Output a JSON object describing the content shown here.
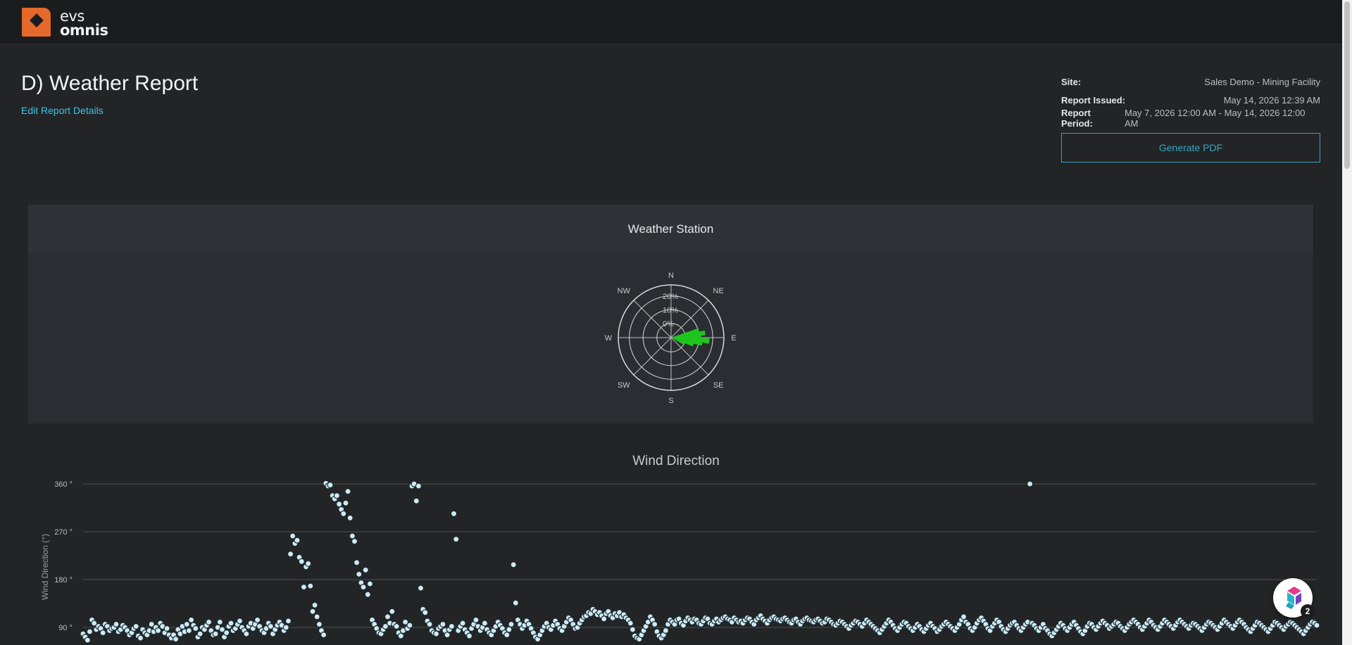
{
  "brand": {
    "line1": "evs",
    "line2": "omnis"
  },
  "page": {
    "title": "D) Weather Report",
    "edit_link": "Edit Report Details"
  },
  "meta": [
    {
      "label": "Site:",
      "value": "Sales Demo - Mining Facility"
    },
    {
      "label": "Report Issued:",
      "value": "May 14, 2026 12:39 AM"
    },
    {
      "label": "Report Period:",
      "value": "May 7, 2026 12:00 AM - May 14, 2026 12:00 AM"
    }
  ],
  "generate_pdf_label": "Generate PDF",
  "station": {
    "title": "Weather Station",
    "compass": [
      "N",
      "NE",
      "E",
      "SE",
      "S",
      "SW",
      "W",
      "NW"
    ],
    "rings": [
      "0%",
      "10%",
      "20%"
    ],
    "petal_color": "#1ec51e"
  },
  "wind": {
    "title": "Wind Direction",
    "ylabel": "Wind Direction (°)",
    "ticks": [
      "360 °",
      "270 °",
      "180 °",
      "90 °"
    ]
  },
  "help_badge": "2",
  "chart_data": [
    {
      "type": "scatter",
      "subtype": "wind-rose",
      "title": "Weather Station",
      "directions": [
        "N",
        "NE",
        "E",
        "SE",
        "S",
        "SW",
        "W",
        "NW"
      ],
      "radial_ticks": [
        "0%",
        "10%",
        "20%"
      ],
      "petals": [
        {
          "direction_deg": 75,
          "percent": 18
        },
        {
          "direction_deg": 82,
          "percent": 22
        },
        {
          "direction_deg": 88,
          "percent": 19
        },
        {
          "direction_deg": 95,
          "percent": 25
        },
        {
          "direction_deg": 101,
          "percent": 20
        },
        {
          "direction_deg": 108,
          "percent": 14
        },
        {
          "direction_deg": 115,
          "percent": 8
        }
      ]
    },
    {
      "type": "scatter",
      "title": "Wind Direction",
      "ylabel": "Wind Direction (°)",
      "ylim": [
        60,
        360
      ],
      "yticks": [
        90,
        180,
        270,
        360
      ],
      "point_color": "#cfeaf2",
      "y": [
        78,
        72,
        66,
        82,
        104,
        98,
        86,
        92,
        88,
        80,
        96,
        92,
        84,
        88,
        90,
        96,
        82,
        86,
        94,
        90,
        84,
        76,
        80,
        88,
        92,
        74,
        70,
        86,
        80,
        76,
        84,
        96,
        82,
        90,
        84,
        98,
        92,
        80,
        88,
        76,
        70,
        76,
        68,
        86,
        78,
        92,
        82,
        96,
        84,
        104,
        94,
        88,
        72,
        78,
        90,
        86,
        94,
        100,
        84,
        76,
        78,
        90,
        100,
        86,
        72,
        80,
        92,
        98,
        84,
        88,
        96,
        102,
        90,
        84,
        78,
        92,
        98,
        88,
        96,
        104,
        92,
        84,
        80,
        88,
        98,
        92,
        78,
        86,
        94,
        100,
        94,
        84,
        90,
        102,
        228,
        262,
        248,
        254,
        222,
        214,
        166,
        204,
        210,
        168,
        120,
        132,
        110,
        96,
        84,
        76,
        361,
        356,
        358,
        338,
        332,
        338,
        322,
        312,
        304,
        324,
        346,
        296,
        262,
        252,
        212,
        190,
        174,
        166,
        198,
        152,
        172,
        104,
        96,
        88,
        80,
        78,
        86,
        92,
        110,
        98,
        120,
        96,
        92,
        80,
        74,
        84,
        100,
        88,
        94,
        356,
        360,
        328,
        356,
        164,
        124,
        118,
        102,
        96,
        84,
        80,
        78,
        88,
        92,
        96,
        84,
        76,
        86,
        92,
        304,
        256,
        84,
        92,
        98,
        86,
        80,
        74,
        88,
        96,
        104,
        92,
        84,
        90,
        98,
        86,
        80,
        76,
        84,
        92,
        100,
        94,
        88,
        80,
        76,
        86,
        96,
        208,
        136,
        104,
        96,
        88,
        94,
        102,
        96,
        88,
        80,
        72,
        68,
        76,
        84,
        92,
        98,
        90,
        86,
        94,
        102,
        96,
        88,
        84,
        92,
        100,
        108,
        104,
        96,
        88,
        90,
        98,
        104,
        110,
        112,
        118,
        116,
        124,
        120,
        114,
        118,
        112,
        106,
        116,
        120,
        112,
        108,
        116,
        112,
        118,
        110,
        114,
        108,
        104,
        98,
        86,
        74,
        70,
        68,
        76,
        84,
        92,
        100,
        110,
        104,
        96,
        82,
        74,
        70,
        76,
        84,
        96,
        104,
        100,
        96,
        104,
        106,
        98,
        94,
        102,
        108,
        104,
        100,
        106,
        104,
        98,
        96,
        102,
        108,
        106,
        98,
        96,
        102,
        106,
        100,
        104,
        108,
        110,
        106,
        104,
        100,
        108,
        104,
        100,
        102,
        98,
        104,
        108,
        106,
        100,
        96,
        104,
        108,
        112,
        106,
        102,
        98,
        104,
        108,
        110,
        106,
        104,
        102,
        106,
        108,
        104,
        100,
        98,
        104,
        106,
        100,
        96,
        102,
        106,
        108,
        104,
        102,
        100,
        104,
        106,
        102,
        98,
        100,
        106,
        104,
        100,
        96,
        94,
        98,
        102,
        100,
        96,
        92,
        88,
        94,
        98,
        102,
        100,
        96,
        92,
        98,
        104,
        100,
        96,
        92,
        88,
        84,
        80,
        86,
        92,
        98,
        104,
        100,
        94,
        88,
        84,
        90,
        96,
        100,
        98,
        92,
        88,
        84,
        90,
        96,
        92,
        86,
        82,
        88,
        94,
        98,
        92,
        88,
        82,
        86,
        92,
        96,
        100,
        96,
        92,
        88,
        84,
        90,
        96,
        104,
        110,
        100,
        96,
        88,
        84,
        90,
        98,
        104,
        108,
        102,
        96,
        88,
        84,
        92,
        98,
        104,
        100,
        92,
        86,
        82,
        88,
        94,
        98,
        100,
        94,
        88,
        84,
        90,
        96,
        100,
        360,
        98,
        94,
        88,
        84,
        90,
        96,
        88,
        84,
        78,
        74,
        80,
        86,
        92,
        98,
        94,
        88,
        84,
        90,
        96,
        100,
        94,
        88,
        82,
        78,
        84,
        92,
        98,
        96,
        90,
        86,
        92,
        98,
        102,
        98,
        94,
        88,
        92,
        96,
        100,
        98,
        92,
        88,
        84,
        90,
        96,
        100,
        104,
        100,
        96,
        90,
        86,
        92,
        98,
        104,
        100,
        94,
        90,
        86,
        92,
        98,
        104,
        100,
        96,
        92,
        88,
        94,
        100,
        104,
        100,
        96,
        92,
        88,
        94,
        98,
        96,
        92,
        88,
        84,
        90,
        96,
        100,
        98,
        94,
        90,
        86,
        92,
        98,
        104,
        100,
        96,
        92,
        88,
        94,
        100,
        104,
        100,
        96,
        90,
        86,
        82,
        88,
        94,
        100,
        98,
        94,
        90,
        86,
        82,
        88,
        94,
        100,
        98,
        94,
        90,
        86,
        92,
        96,
        100,
        98,
        94,
        90,
        86,
        82,
        78,
        84,
        90,
        96,
        100,
        98,
        94
      ]
    }
  ]
}
